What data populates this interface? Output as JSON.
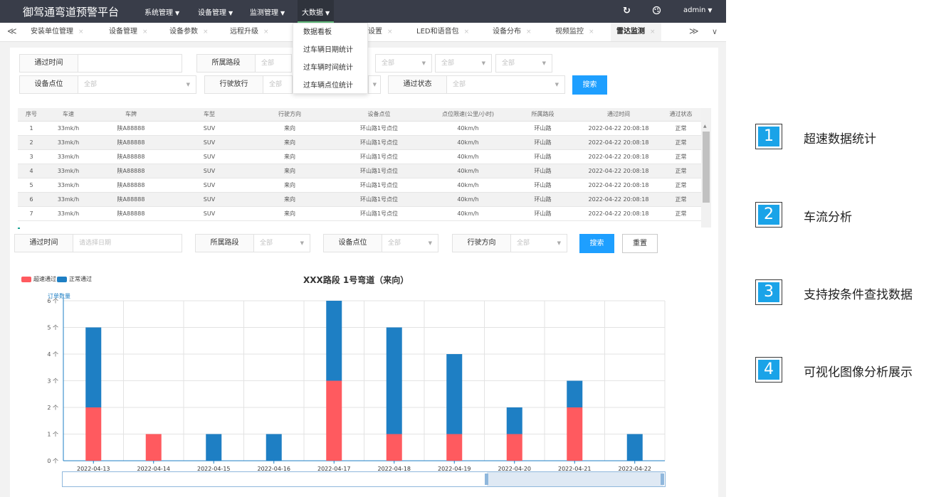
{
  "app": {
    "brand": "御驾通弯道预警平台",
    "menus": [
      "系统管理",
      "设备管理",
      "监测管理",
      "大数据"
    ],
    "user": "admin",
    "caret": "▼"
  },
  "tabs": {
    "items": [
      "安装单位管理",
      "设备管理",
      "设备参数",
      "远程升级",
      "设置",
      "LED和语音包",
      "设备分布",
      "视频监控",
      "雷达监测"
    ],
    "current": "雷达监测",
    "close": "×",
    "prev": "≪",
    "next": "≫",
    "more": "∨"
  },
  "dropdown": {
    "items": [
      "数据看板",
      "过车辆日期统计",
      "过车辆时间统计",
      "过车辆点位统计"
    ]
  },
  "filter1": {
    "time_label": "通过时间",
    "road_label": "所属路段",
    "point_label": "设备点位",
    "direction_label": "行驶放行",
    "status_label": "通过状态",
    "all": "全部",
    "search": "搜索"
  },
  "table": {
    "headers": [
      "序号",
      "车速",
      "车牌",
      "车型",
      "行驶方向",
      "设备点位",
      "点位限速(公里/小时)",
      "所属路段",
      "通过时间",
      "通过状态"
    ],
    "rows": [
      [
        "1",
        "33mk/h",
        "陕A88888",
        "SUV",
        "来向",
        "环山路1号点位",
        "40km/h",
        "环山路",
        "2022-04-22 20:08:18",
        "正常"
      ],
      [
        "2",
        "33mk/h",
        "陕A88888",
        "SUV",
        "来向",
        "环山路1号点位",
        "40km/h",
        "环山路",
        "2022-04-22 20:08:18",
        "正常"
      ],
      [
        "3",
        "33mk/h",
        "陕A88888",
        "SUV",
        "来向",
        "环山路1号点位",
        "40km/h",
        "环山路",
        "2022-04-22 20:08:18",
        "正常"
      ],
      [
        "4",
        "33mk/h",
        "陕A88888",
        "SUV",
        "来向",
        "环山路1号点位",
        "40km/h",
        "环山路",
        "2022-04-22 20:08:18",
        "正常"
      ],
      [
        "5",
        "33mk/h",
        "陕A88888",
        "SUV",
        "来向",
        "环山路1号点位",
        "40km/h",
        "环山路",
        "2022-04-22 20:08:18",
        "正常"
      ],
      [
        "6",
        "33mk/h",
        "陕A88888",
        "SUV",
        "来向",
        "环山路1号点位",
        "40km/h",
        "环山路",
        "2022-04-22 20:08:18",
        "正常"
      ],
      [
        "7",
        "33mk/h",
        "陕A88888",
        "SUV",
        "来向",
        "环山路1号点位",
        "40km/h",
        "环山路",
        "2022-04-22 20:08:18",
        "正常"
      ]
    ]
  },
  "filter2": {
    "time_label": "通过时间",
    "time_placeholder": "请选择日期",
    "road_label": "所属路段",
    "point_label": "设备点位",
    "direction_label": "行驶方向",
    "all": "全部",
    "search": "搜索",
    "reset": "重置"
  },
  "chart_data": {
    "type": "bar",
    "stacked": true,
    "title": "XXX路段 1号弯道（来向）",
    "ylabel": "订单数量",
    "xlabel": "",
    "categories": [
      "2022-04-13",
      "2022-04-14",
      "2022-04-15",
      "2022-04-16",
      "2022-04-17",
      "2022-04-18",
      "2022-04-19",
      "2022-04-20",
      "2022-04-21",
      "2022-04-22"
    ],
    "series": [
      {
        "name": "超速通过",
        "color": "#ff5a5f",
        "values": [
          2,
          1,
          0,
          0,
          3,
          1,
          1,
          1,
          2,
          0
        ]
      },
      {
        "name": "正常通过",
        "color": "#1e7fc4",
        "values": [
          3,
          0,
          1,
          1,
          3,
          4,
          3,
          1,
          1,
          1
        ]
      }
    ],
    "ylim": [
      0,
      6
    ],
    "yticks": [
      "0 个",
      "1 个",
      "2 个",
      "3 个",
      "4 个",
      "5 个",
      "6 个"
    ],
    "grid": true,
    "legend": "top-left"
  },
  "features": [
    {
      "num": "1",
      "text": "超速数据统计"
    },
    {
      "num": "2",
      "text": "车流分析"
    },
    {
      "num": "3",
      "text": "支持按条件查找数据"
    },
    {
      "num": "4",
      "text": "可视化图像分析展示"
    }
  ]
}
